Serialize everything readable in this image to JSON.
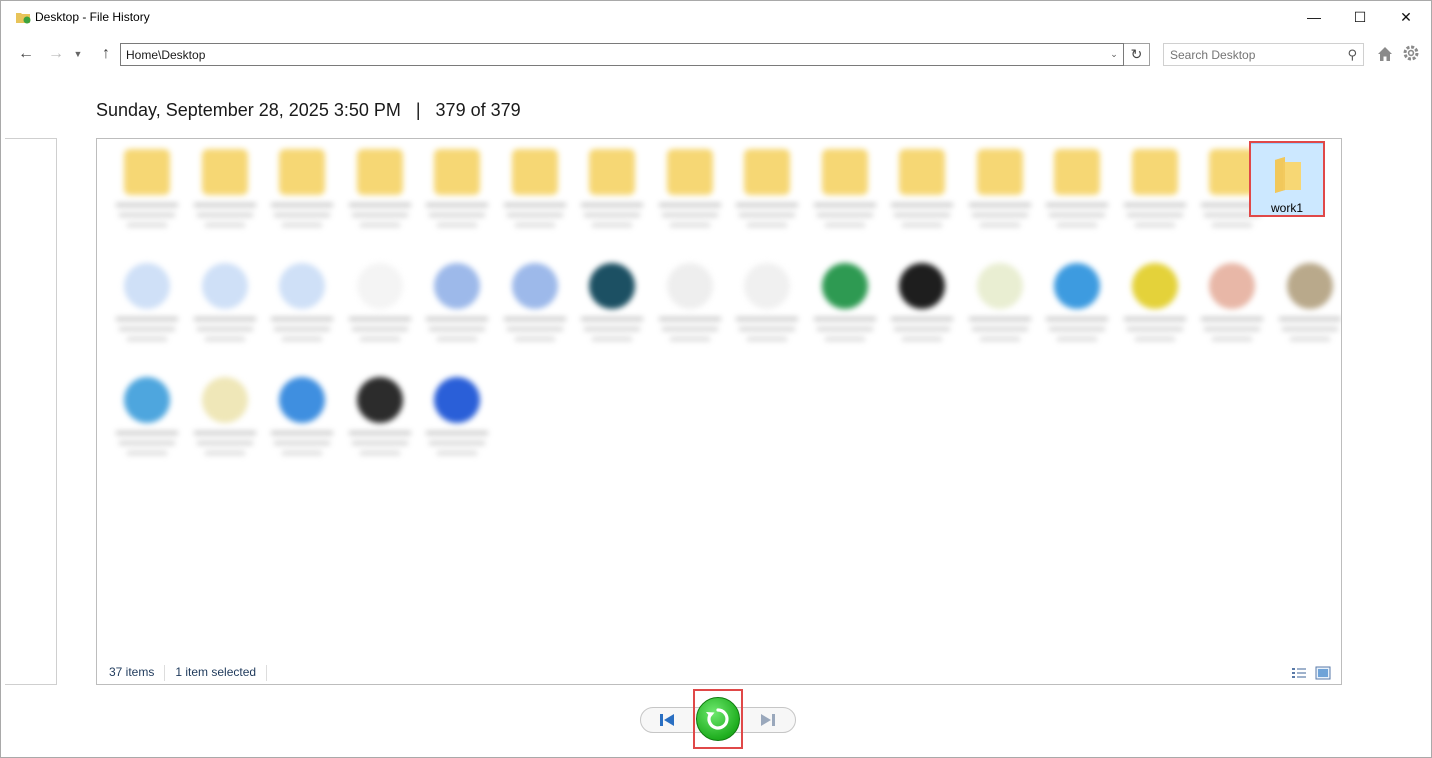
{
  "window": {
    "title": "Desktop - File History",
    "minimize_label": "—",
    "maximize_label": "☐",
    "close_label": "✕"
  },
  "navigation": {
    "address": "Home\\Desktop",
    "search_placeholder": "Search Desktop"
  },
  "snapshot": {
    "header": "Sunday, September 28, 2025 3:50 PM   |   379 of 379"
  },
  "folder_view": {
    "selected_item": "work1",
    "item_count": "37 items",
    "selection_status": "1 item selected"
  },
  "colors": {
    "accent_highlight": "#e04848",
    "selection_bg": "#cce8ff",
    "restore_green": "#1fae1f",
    "folder_yellow": "#f6d774"
  },
  "icons": {
    "back": "back-arrow-icon",
    "forward": "forward-arrow-icon",
    "up": "up-arrow-icon",
    "refresh": "refresh-icon",
    "search": "search-icon",
    "home": "home-icon",
    "settings": "gear-icon",
    "previous_version": "previous-version-icon",
    "restore": "restore-icon",
    "next_version": "next-version-icon"
  }
}
